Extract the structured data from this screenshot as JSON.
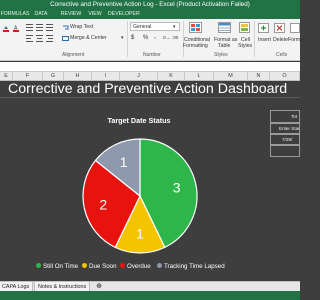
{
  "window": {
    "title": "Corrective and Preventive Action Log - Excel (Product Activation Failed)"
  },
  "ribbon_tabs": [
    "FORMULAS",
    "DATA",
    "REVIEW",
    "VIEW",
    "DEVELOPER"
  ],
  "ribbon": {
    "wrap_text_label": "Wrap Text",
    "merge_center_label": "Merge & Center",
    "number_format_value": "General",
    "currency_symbol": "$",
    "percent_symbol": "%",
    "comma_symbol": ",",
    "conditional_formatting_label_1": "Conditional",
    "conditional_formatting_label_2": "Formatting",
    "format_as_table_label_1": "Format as",
    "format_as_table_label_2": "Table",
    "cell_styles_label_1": "Cell",
    "cell_styles_label_2": "Styles",
    "insert_label": "Insert",
    "delete_label": "Delete",
    "format_label": "Format",
    "group_alignment": "Alignment",
    "group_number": "Number",
    "group_styles": "Styles",
    "group_cells": "Cells"
  },
  "columns": [
    "E",
    "F",
    "G",
    "H",
    "I",
    "J",
    "K",
    "L",
    "M",
    "N",
    "O"
  ],
  "dashboard": {
    "title": "Corrective and Preventive Action Dashboard"
  },
  "right_table": {
    "header": "Tot",
    "label": "Enter Star",
    "date": "7/29/"
  },
  "chart_data": {
    "type": "pie",
    "title": "Target Date Status",
    "slices": [
      {
        "label": "Still On Time",
        "value": 3,
        "color": "#2fb64a"
      },
      {
        "label": "Due Soon",
        "value": 1,
        "color": "#f4c400"
      },
      {
        "label": "Overdue",
        "value": 2,
        "color": "#e8130f"
      },
      {
        "label": "Tracking Time Lapsed",
        "value": 1,
        "color": "#8f99ad"
      }
    ],
    "legend_position": "bottom"
  },
  "sheet_tabs": [
    "CAPA Logs",
    "Notes & Instructions"
  ]
}
